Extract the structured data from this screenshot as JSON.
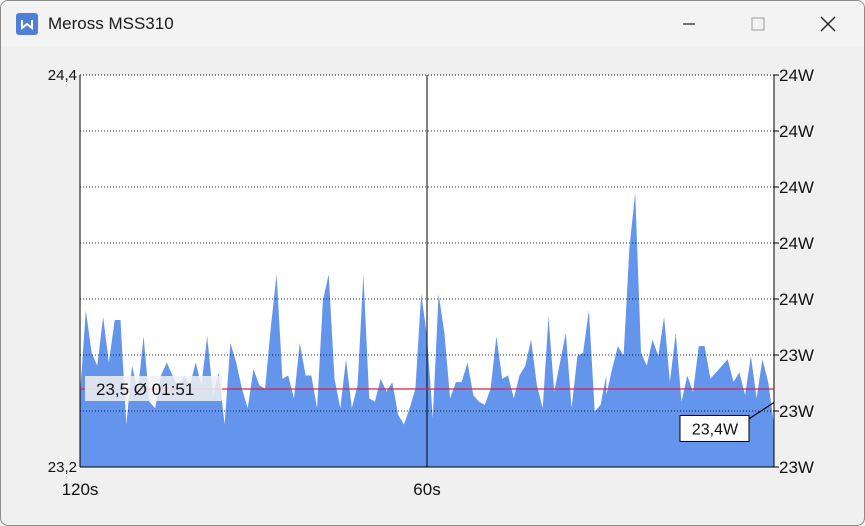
{
  "window": {
    "title": "Meross MSS310",
    "icon": "meross-logo-icon",
    "controls": [
      "minimize-icon",
      "maximize-icon",
      "close-icon"
    ]
  },
  "chart_data": {
    "type": "area",
    "y_left": {
      "top": "24,4",
      "bottom": "23,2",
      "ylim": [
        23.2,
        24.4
      ]
    },
    "y_right_ticks": [
      "24W",
      "24W",
      "24W",
      "24W",
      "24W",
      "23W",
      "23W",
      "23W"
    ],
    "x_ticks": [
      "120s",
      "60s"
    ],
    "grid": "horizontal-dotted",
    "area_color": "#6495ed",
    "average": {
      "value": 23.5,
      "label": "23,5 Ø 01:51",
      "color": "#d62050"
    },
    "current": {
      "label": "23,4W"
    },
    "x": [
      120,
      119,
      118,
      117,
      116,
      115,
      114,
      113,
      112,
      111,
      110,
      109,
      108,
      107,
      106,
      105,
      104,
      103,
      102,
      101,
      100,
      99,
      98,
      97,
      96,
      95,
      94,
      93,
      92,
      91,
      90,
      89,
      88,
      87,
      86,
      85,
      84,
      83,
      82,
      81,
      80,
      79,
      78,
      77,
      76,
      75,
      74,
      73,
      72,
      71,
      70,
      69,
      68,
      67,
      66,
      65,
      64,
      63,
      62,
      61,
      60,
      59,
      58,
      57,
      56,
      55,
      54,
      53,
      52,
      51,
      50,
      49,
      48,
      47,
      46,
      45,
      44,
      43,
      42,
      41,
      40,
      39,
      38,
      37,
      36,
      35,
      34,
      33,
      32,
      31,
      30,
      29,
      29,
      28,
      27,
      26,
      25,
      24,
      23,
      22,
      21,
      20,
      19,
      18,
      17,
      16,
      15,
      14,
      13,
      12,
      11,
      10,
      9,
      8,
      7,
      6,
      5,
      4,
      3,
      2,
      1,
      0
    ],
    "values": [
      23.42,
      23.68,
      23.55,
      23.51,
      23.66,
      23.52,
      23.65,
      23.65,
      23.33,
      23.51,
      23.43,
      23.6,
      23.4,
      23.38,
      23.48,
      23.52,
      23.48,
      23.44,
      23.48,
      23.45,
      23.52,
      23.45,
      23.6,
      23.42,
      23.49,
      23.33,
      23.58,
      23.52,
      23.44,
      23.38,
      23.5,
      23.45,
      23.44,
      23.63,
      23.79,
      23.47,
      23.48,
      23.41,
      23.58,
      23.48,
      23.48,
      23.38,
      23.71,
      23.79,
      23.47,
      23.38,
      23.53,
      23.38,
      23.45,
      23.79,
      23.41,
      23.4,
      23.47,
      23.43,
      23.46,
      23.36,
      23.33,
      23.38,
      23.44,
      23.73,
      23.6,
      23.35,
      23.73,
      23.61,
      23.41,
      23.46,
      23.46,
      23.52,
      23.42,
      23.4,
      23.39,
      23.44,
      23.6,
      23.47,
      23.48,
      23.41,
      23.48,
      23.51,
      23.59,
      23.45,
      23.38,
      23.66,
      23.43,
      23.52,
      23.61,
      23.38,
      23.54,
      23.55,
      23.68,
      23.37,
      23.39,
      23.48,
      23.42,
      23.5,
      23.57,
      23.54,
      23.87,
      24.04,
      23.55,
      23.51,
      23.59,
      23.54,
      23.66,
      23.46,
      23.61,
      23.4,
      23.48,
      23.43,
      23.57,
      23.57,
      23.47,
      23.49,
      23.51,
      23.53,
      23.46,
      23.49,
      23.42,
      23.54,
      23.41,
      23.53,
      23.46,
      23.33,
      23.52
    ]
  }
}
